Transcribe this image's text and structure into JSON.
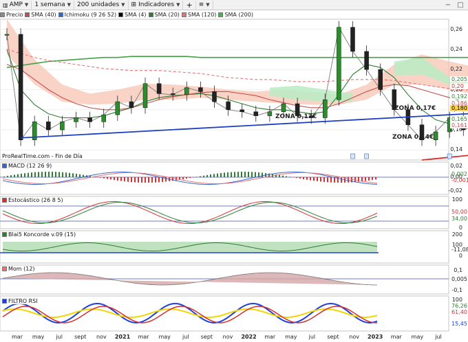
{
  "toolbar": {
    "symbol": "AMP",
    "period": "1 semana",
    "units": "200 unidades",
    "indicators": "Indicadores",
    "add_icon": "plus-icon",
    "tools_icon": "sliders-icon",
    "minimize_icon": "minus-icon",
    "maximize_icon": "maximize-icon"
  },
  "legend": [
    {
      "label": "Precio",
      "color": "#8a8a8a"
    },
    {
      "label": "SMA (40)",
      "color": "#c0504d"
    },
    {
      "label": "Ichimoku (9 26 52)",
      "color": "#3366cc"
    },
    {
      "label": "SMA (4)",
      "color": "#000000"
    },
    {
      "label": "SMA (20)",
      "color": "#2e7d32"
    },
    {
      "label": "SMA (120)",
      "color": "#e57373"
    },
    {
      "label": "SMA (200)",
      "color": "#4caf50"
    }
  ],
  "watermark": "ProRealTime.com - Fin de Día",
  "annotations": [
    {
      "text": "ZONA 0,17€",
      "color": "#1f3fbf"
    },
    {
      "text": "ZONA 0,17€",
      "color": "#1f3fbf"
    },
    {
      "text": "ZONA 0,14€",
      "color": "#d32f2f"
    }
  ],
  "price_axis": [
    "0,26",
    "0,24",
    "0,22",
    "0,20",
    "0,18",
    "0,16",
    "0,14"
  ],
  "price_tags": [
    {
      "text": "0,205",
      "color": "#2e7d32",
      "bg": "#ffffff"
    },
    {
      "text": "0,20",
      "color": "#d32f2f",
      "bg": "#ffffff"
    },
    {
      "text": "0,192",
      "color": "#2e7d32",
      "bg": "#ffffff"
    },
    {
      "text": "0,186",
      "color": "#c0504d",
      "bg": "#ffffff"
    },
    {
      "text": "0,180",
      "color": "#000000",
      "bg": "#ffd54f"
    },
    {
      "text": "0,165",
      "color": "#2e7d32",
      "bg": "#ffffff"
    },
    {
      "text": "0,161",
      "color": "#c0504d",
      "bg": "#ffffff"
    }
  ],
  "panels": {
    "macd": {
      "label": "MACD (12 26 9)",
      "ticks": [
        "0,02",
        "0,00",
        "-0,02"
      ],
      "values": [
        "0,002",
        "-0,001"
      ]
    },
    "stoch": {
      "label": "Estocástico (26 8 5)",
      "ticks": [
        "100",
        "0"
      ],
      "values": [
        "50,00",
        "34,00"
      ]
    },
    "blai5": {
      "label": "Blai5 Koncorde v.09 (15)",
      "ticks": [
        "200",
        "100",
        "0"
      ],
      "values": [
        "-11,08"
      ]
    },
    "mom": {
      "label": "Mom (12)",
      "ticks": [
        "0,1",
        "-0,1"
      ],
      "values": [
        "0,005"
      ]
    },
    "rsi": {
      "label": "FILTRO RSI",
      "ticks": [
        "100"
      ],
      "values": [
        "76,26",
        "61,40",
        "15,45"
      ]
    }
  },
  "x_axis": [
    {
      "label": "mar",
      "year": false
    },
    {
      "label": "may",
      "year": false
    },
    {
      "label": "jul",
      "year": false
    },
    {
      "label": "sept",
      "year": false
    },
    {
      "label": "nov",
      "year": false
    },
    {
      "label": "2021",
      "year": true
    },
    {
      "label": "mar",
      "year": false
    },
    {
      "label": "may",
      "year": false
    },
    {
      "label": "jul",
      "year": false
    },
    {
      "label": "sept",
      "year": false
    },
    {
      "label": "nov",
      "year": false
    },
    {
      "label": "2022",
      "year": true
    },
    {
      "label": "mar",
      "year": false
    },
    {
      "label": "may",
      "year": false
    },
    {
      "label": "jul",
      "year": false
    },
    {
      "label": "sept",
      "year": false
    },
    {
      "label": "nov",
      "year": false
    },
    {
      "label": "2023",
      "year": true
    },
    {
      "label": "mar",
      "year": false
    },
    {
      "label": "may",
      "year": false
    },
    {
      "label": "jul",
      "year": false
    }
  ],
  "chart_data": {
    "type": "line",
    "title": "",
    "xlabel": "",
    "ylabel": "",
    "ylim": [
      0.13,
      0.27
    ],
    "x": [
      "2020-03",
      "2020-04",
      "2020-05",
      "2020-06",
      "2020-07",
      "2020-08",
      "2020-09",
      "2020-10",
      "2020-11",
      "2020-12",
      "2021-01",
      "2021-02",
      "2021-03",
      "2021-04",
      "2021-05",
      "2021-06",
      "2021-07",
      "2021-08",
      "2021-09",
      "2021-10",
      "2021-11",
      "2021-12",
      "2022-01",
      "2022-02",
      "2022-03",
      "2022-04",
      "2022-05",
      "2022-06",
      "2022-07",
      "2022-08",
      "2022-09",
      "2022-10",
      "2022-11",
      "2022-12",
      "2023-01",
      "2023-02"
    ],
    "series": [
      {
        "name": "Precio",
        "values": [
          0.255,
          0.15,
          0.168,
          0.16,
          0.168,
          0.172,
          0.168,
          0.175,
          0.188,
          0.182,
          0.206,
          0.196,
          0.195,
          0.202,
          0.198,
          0.188,
          0.18,
          0.178,
          0.174,
          0.178,
          0.186,
          0.174,
          0.172,
          0.19,
          0.262,
          0.238,
          0.22,
          0.2,
          0.18,
          0.165,
          0.15,
          0.158,
          0.172,
          0.16,
          0.165,
          0.18
        ]
      },
      {
        "name": "SMA (20)",
        "values": [
          0.24,
          0.2,
          0.185,
          0.176,
          0.172,
          0.172,
          0.172,
          0.174,
          0.178,
          0.182,
          0.188,
          0.192,
          0.194,
          0.195,
          0.196,
          0.194,
          0.19,
          0.186,
          0.182,
          0.18,
          0.18,
          0.178,
          0.176,
          0.178,
          0.195,
          0.215,
          0.225,
          0.222,
          0.212,
          0.195,
          0.18,
          0.17,
          0.166,
          0.165,
          0.164,
          0.165
        ]
      },
      {
        "name": "SMA (200)",
        "values": [
          0.222,
          0.224,
          0.226,
          0.228,
          0.229,
          0.23,
          0.231,
          0.232,
          0.232,
          0.233,
          0.233,
          0.233,
          0.233,
          0.233,
          0.232,
          0.232,
          0.232,
          0.232,
          0.232,
          0.232,
          0.232,
          0.232,
          0.232,
          0.232,
          0.232,
          0.232,
          0.232,
          0.232,
          0.232,
          0.232,
          0.232,
          0.232,
          0.232,
          0.232,
          0.232,
          0.232
        ]
      },
      {
        "name": "SMA (120)",
        "values": [
          0.24,
          0.236,
          0.232,
          0.229,
          0.227,
          0.225,
          0.223,
          0.221,
          0.22,
          0.219,
          0.219,
          0.219,
          0.218,
          0.217,
          0.216,
          0.214,
          0.212,
          0.211,
          0.21,
          0.21,
          0.209,
          0.208,
          0.208,
          0.208,
          0.209,
          0.21,
          0.21,
          0.21,
          0.209,
          0.207,
          0.205,
          0.203,
          0.201,
          0.2,
          0.199,
          0.199
        ]
      },
      {
        "name": "SMA (40)",
        "values": [
          0.225,
          0.22,
          0.21,
          0.2,
          0.192,
          0.186,
          0.182,
          0.18,
          0.18,
          0.182,
          0.186,
          0.19,
          0.193,
          0.195,
          0.197,
          0.198,
          0.198,
          0.196,
          0.194,
          0.19,
          0.187,
          0.184,
          0.182,
          0.182,
          0.186,
          0.192,
          0.198,
          0.203,
          0.205,
          0.204,
          0.2,
          0.196,
          0.192,
          0.188,
          0.186,
          0.186
        ]
      }
    ],
    "trendlines": [
      {
        "name": "ZONA 0,17€",
        "from": [
          "2020-04",
          0.152
        ],
        "to": [
          "2023-03",
          0.178
        ]
      },
      {
        "name": "ZONA 0,14€",
        "from": [
          "2022-09",
          0.13
        ],
        "to": [
          "2023-08",
          0.145
        ]
      }
    ]
  }
}
